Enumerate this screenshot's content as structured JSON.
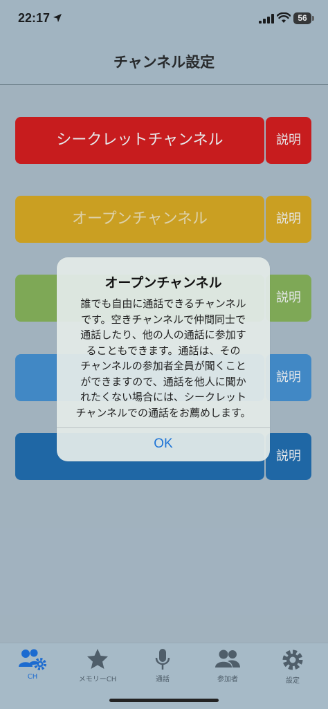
{
  "status_bar": {
    "time": "22:17",
    "battery_level": "56"
  },
  "nav": {
    "title": "チャンネル設定"
  },
  "channels": [
    {
      "label": "シークレットチャンネル",
      "explain": "説明",
      "color": "#d90000",
      "text_color": "#ffffff",
      "explain_color": "#d90000"
    },
    {
      "label": "オープンチャンネル",
      "explain": "説明",
      "color": "#dca406",
      "text_color": "#f4e3b0",
      "explain_color": "#dca406"
    },
    {
      "label": "",
      "explain": "説明",
      "color": "#7db046",
      "text_color": "#ffffff",
      "explain_color": "#7db046"
    },
    {
      "label": "",
      "explain": "説明",
      "color": "#3188d1",
      "text_color": "#ffffff",
      "explain_color": "#3188d1"
    },
    {
      "label": "",
      "explain": "説明",
      "color": "#075ea9",
      "text_color": "#ffffff",
      "explain_color": "#075ea9"
    }
  ],
  "alert": {
    "title": "オープンチャンネル",
    "message_lines": [
      "誰でも自由に通話できるチャンネル",
      "です。空きチャンネルで仲間同士で",
      "通話したり、他の人の通話に参加す",
      "ることもできます。通話は、その",
      "チャンネルの参加者全員が聞くこと",
      "ができますので、通話を他人に聞か",
      "れたくない場合には、シークレット",
      "チャンネルでの通話をお薦めします。"
    ],
    "ok_label": "OK"
  },
  "tabs": [
    {
      "label": "CH",
      "icon": "people-gear-icon",
      "active": true
    },
    {
      "label": "メモリーCH",
      "icon": "star-icon",
      "active": false
    },
    {
      "label": "通話",
      "icon": "microphone-icon",
      "active": false
    },
    {
      "label": "参加者",
      "icon": "people-icon",
      "active": false
    },
    {
      "label": "設定",
      "icon": "gear-icon",
      "active": false
    }
  ],
  "colors": {
    "accent": "#1c6bd0",
    "background": "#a9bcc9"
  }
}
